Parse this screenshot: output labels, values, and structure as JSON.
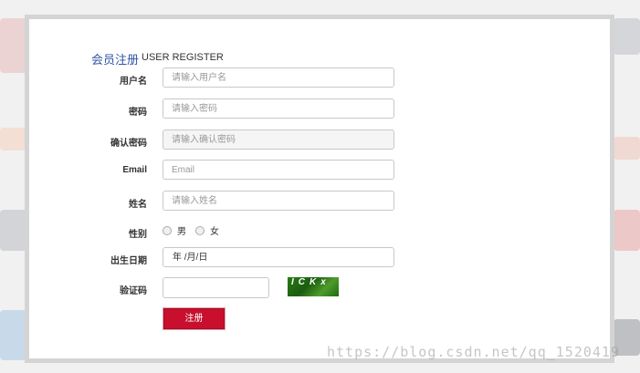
{
  "form": {
    "title": "会员注册",
    "subtitle": "USER REGISTER",
    "fields": {
      "username": {
        "label": "用户名",
        "placeholder": "请输入用户名"
      },
      "password": {
        "label": "密码",
        "placeholder": "请输入密码"
      },
      "confirm": {
        "label": "确认密码",
        "placeholder": "请输入确认密码"
      },
      "email": {
        "label": "Email",
        "placeholder": "Email"
      },
      "name": {
        "label": "姓名",
        "placeholder": "请输入姓名"
      }
    },
    "gender": {
      "label": "性别",
      "male": "男",
      "female": "女"
    },
    "birthdate": {
      "label": "出生日期",
      "value": "年 /月/日"
    },
    "captcha": {
      "label": "验证码",
      "code": "ICKx"
    },
    "submit_label": "注册"
  },
  "watermark": "https://blog.csdn.net/qq_1520419"
}
